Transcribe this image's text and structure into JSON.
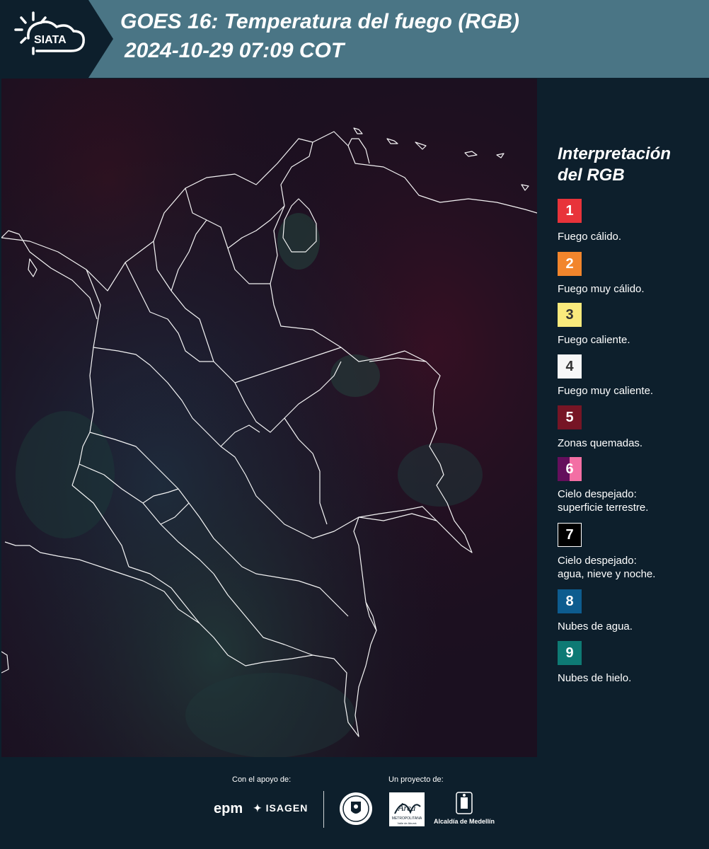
{
  "header": {
    "logo_text": "SIATA",
    "title_line1": "GOES 16: Temperatura del fuego (RGB)",
    "title_line2": "2024-10-29 07:09 COT"
  },
  "legend": {
    "title_line1": "Interpretación",
    "title_line2": "del RGB",
    "items": [
      {
        "number": "1",
        "label": "Fuego cálido.",
        "color": "#e8333a"
      },
      {
        "number": "2",
        "label": "Fuego muy cálido.",
        "color": "#f2852c"
      },
      {
        "number": "3",
        "label": "Fuego caliente.",
        "color": "#faea7c"
      },
      {
        "number": "4",
        "label": "Fuego muy caliente.",
        "color": "#f7f7f7"
      },
      {
        "number": "5",
        "label": "Zonas quemadas.",
        "color": "#761525"
      },
      {
        "number": "6",
        "label_line1": "Cielo despejado:",
        "label_line2": "superficie terrestre.",
        "color": "#640f5c",
        "color2": "#f36fa4"
      },
      {
        "number": "7",
        "label_line1": "Cielo despejado:",
        "label_line2": "agua, nieve y noche.",
        "color": "#000000"
      },
      {
        "number": "8",
        "label": "Nubes de agua.",
        "color": "#0d5c8f"
      },
      {
        "number": "9",
        "label": "Nubes de hielo.",
        "color": "#0e7a74"
      }
    ]
  },
  "footer": {
    "support_caption": "Con el apoyo de:",
    "project_caption": "Un proyecto de:",
    "epm_logo_text": "epm",
    "isagen_logo_text": "ISAGEN",
    "area_logo_text": "Área",
    "area_logo_subtext": "METROPOLITANA",
    "area_logo_subtext2": "Valle de Aburrá",
    "alcaldia_text": "Alcaldía de Medellín"
  },
  "colors": {
    "header_bg": "#4a7585",
    "logo_bg": "#0d1f2c",
    "panel_bg": "#0d1f2c",
    "map_base": "#1b1020",
    "map_land_tint": "#1a2c3c",
    "map_red_tint": "#3a0c1c",
    "border_line": "#ffffff"
  }
}
